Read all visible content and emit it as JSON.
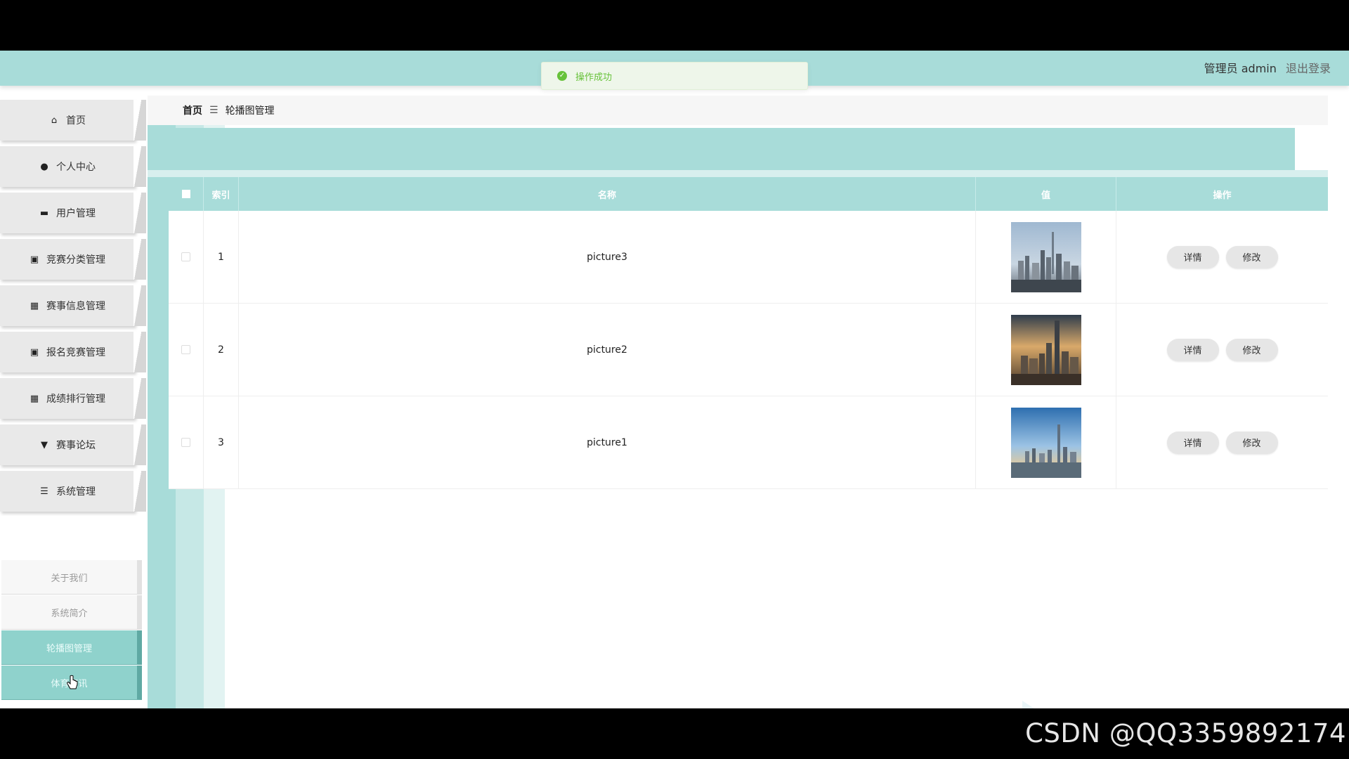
{
  "header": {
    "title": "",
    "user_label": "管理员 admin",
    "logout_label": "退出登录"
  },
  "toast": {
    "message": "操作成功",
    "status_color": "#67c23a"
  },
  "sidebar": {
    "items": [
      {
        "label": "首页",
        "icon": "home-icon"
      },
      {
        "label": "个人中心",
        "icon": "user-icon"
      },
      {
        "label": "用户管理",
        "icon": "chat-icon"
      },
      {
        "label": "竞赛分类管理",
        "icon": "clipboard-icon"
      },
      {
        "label": "赛事信息管理",
        "icon": "grid-icon"
      },
      {
        "label": "报名竞赛管理",
        "icon": "clipboard-check-icon"
      },
      {
        "label": "成绩排行管理",
        "icon": "grid-icon"
      },
      {
        "label": "赛事论坛",
        "icon": "comment-icon"
      },
      {
        "label": "系统管理",
        "icon": "list-icon"
      }
    ],
    "sub_items": [
      {
        "label": "关于我们",
        "active": false
      },
      {
        "label": "系统简介",
        "active": false
      },
      {
        "label": "轮播图管理",
        "active": true
      },
      {
        "label": "体育资讯",
        "active": true
      }
    ]
  },
  "breadcrumb": {
    "home": "首页",
    "separator_icon": "menu-icon",
    "current": "轮播图管理"
  },
  "table": {
    "columns": {
      "index": "索引",
      "name": "名称",
      "value": "值",
      "actions": "操作"
    },
    "rows": [
      {
        "index": "1",
        "name": "picture3",
        "image": "city-skyline-thumbnail"
      },
      {
        "index": "2",
        "name": "picture2",
        "image": "city-skyline-thumbnail"
      },
      {
        "index": "3",
        "name": "picture1",
        "image": "city-skyline-thumbnail"
      }
    ],
    "buttons": {
      "detail": "详情",
      "edit": "修改"
    }
  },
  "watermark": "CSDN @QQ3359892174",
  "colors": {
    "accent": "#a8dcd9",
    "active_menu": "#8fd2cc"
  }
}
